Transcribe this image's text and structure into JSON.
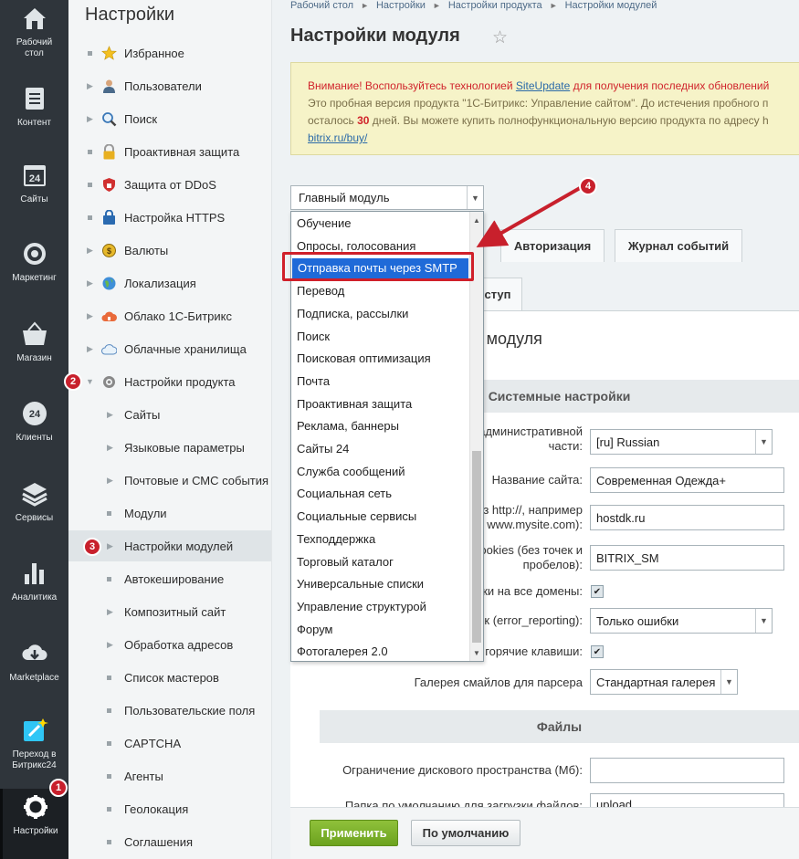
{
  "leftbar": {
    "items": [
      {
        "label": "Рабочий стол",
        "icon": "home-icon"
      },
      {
        "label": "Контент",
        "icon": "document-icon"
      },
      {
        "label": "Сайты",
        "icon": "calendar-24-icon"
      },
      {
        "label": "Маркетинг",
        "icon": "target-icon"
      },
      {
        "label": "Магазин",
        "icon": "basket-icon"
      },
      {
        "label": "Клиенты",
        "icon": "clients-24-icon"
      },
      {
        "label": "Сервисы",
        "icon": "layers-icon"
      },
      {
        "label": "Аналитика",
        "icon": "bar-chart-icon"
      },
      {
        "label": "Marketplace",
        "icon": "cloud-download-icon"
      },
      {
        "label": "Переход в Битрикс24",
        "icon": "bitrix24-icon"
      },
      {
        "label": "Настройки",
        "icon": "gear-icon"
      }
    ],
    "badge": "1"
  },
  "tree": {
    "title": "Настройки",
    "items": [
      "Избранное",
      "Пользователи",
      "Поиск",
      "Проактивная защита",
      "Защита от DDoS",
      "Настройка HTTPS",
      "Валюты",
      "Локализация",
      "Облако 1С-Битрикс",
      "Облачные хранилища",
      "Настройки продукта"
    ],
    "subitems": [
      "Сайты",
      "Языковые параметры",
      "Почтовые и СМС события",
      "Модули",
      "Настройки модулей",
      "Автокеширование",
      "Композитный сайт",
      "Обработка адресов",
      "Список мастеров",
      "Пользовательские поля",
      "CAPTCHA",
      "Агенты",
      "Геолокация",
      "Соглашения"
    ],
    "badge2": "2",
    "badge3": "3"
  },
  "breadcrumb": [
    "Рабочий стол",
    "Настройки",
    "Настройки продукта",
    "Настройки модулей"
  ],
  "page_title": "Настройки модуля",
  "warning": {
    "line1_prefix": "Внимание! Воспользуйтесь технологией ",
    "line1_link": "SiteUpdate",
    "line1_suffix": " для получения последних обновлений",
    "line2": "Это пробная версия продукта \"1С-Битрикс: Управление сайтом\". До истечения пробного п",
    "line3_prefix": "осталось ",
    "line3_days": "30",
    "line3_suffix": " дней. Вы можете купить полнофункциональную версию продукта по адресу h",
    "line4_link": "bitrix.ru/buy/"
  },
  "module_select": {
    "value": "Главный модуль"
  },
  "tabs": [
    "Авторизация",
    "Журнал событий",
    "ступ"
  ],
  "panel": {
    "heading": "ов модуля",
    "section1": "Системные настройки",
    "section2": "Файлы",
    "rows": [
      {
        "label": "административной части:",
        "value": "[ru] Russian"
      },
      {
        "label": "Название сайта:",
        "value": "Современная Одежда+"
      },
      {
        "label": "з http://, например www.mysite.com):",
        "value": "hostdk.ru"
      },
      {
        "label": "cookies (без точек и пробелов):",
        "value": "BITRIX_SM"
      },
      {
        "label": "ки на все домены:",
        "value": "✔"
      },
      {
        "label": "ок (error_reporting):",
        "value": "Только ошибки"
      },
      {
        "label": "горячие клавиши:",
        "value": "✔"
      },
      {
        "label": "Галерея смайлов для парсера",
        "value": "Стандартная галерея"
      },
      {
        "label": "Ограничение дискового пространства (Мб):",
        "value": ""
      },
      {
        "label": "Папка по умолчанию для загрузки файлов:",
        "value": "upload"
      }
    ]
  },
  "buttons": {
    "apply": "Применить",
    "default": "По умолчанию"
  },
  "dropdown": {
    "items": [
      "Обучение",
      "Опросы, голосования",
      "Отправка почты через SMTP",
      "Перевод",
      "Подписка, рассылки",
      "Поиск",
      "Поисковая оптимизация",
      "Почта",
      "Проактивная защита",
      "Реклама, баннеры",
      "Сайты 24",
      "Служба сообщений",
      "Социальная сеть",
      "Социальные сервисы",
      "Техподдержка",
      "Торговый каталог",
      "Универсальные списки",
      "Управление структурой",
      "Форум",
      "Фотогалерея 2.0"
    ],
    "selected_index": 2
  },
  "annotation": {
    "badge4": "4"
  }
}
